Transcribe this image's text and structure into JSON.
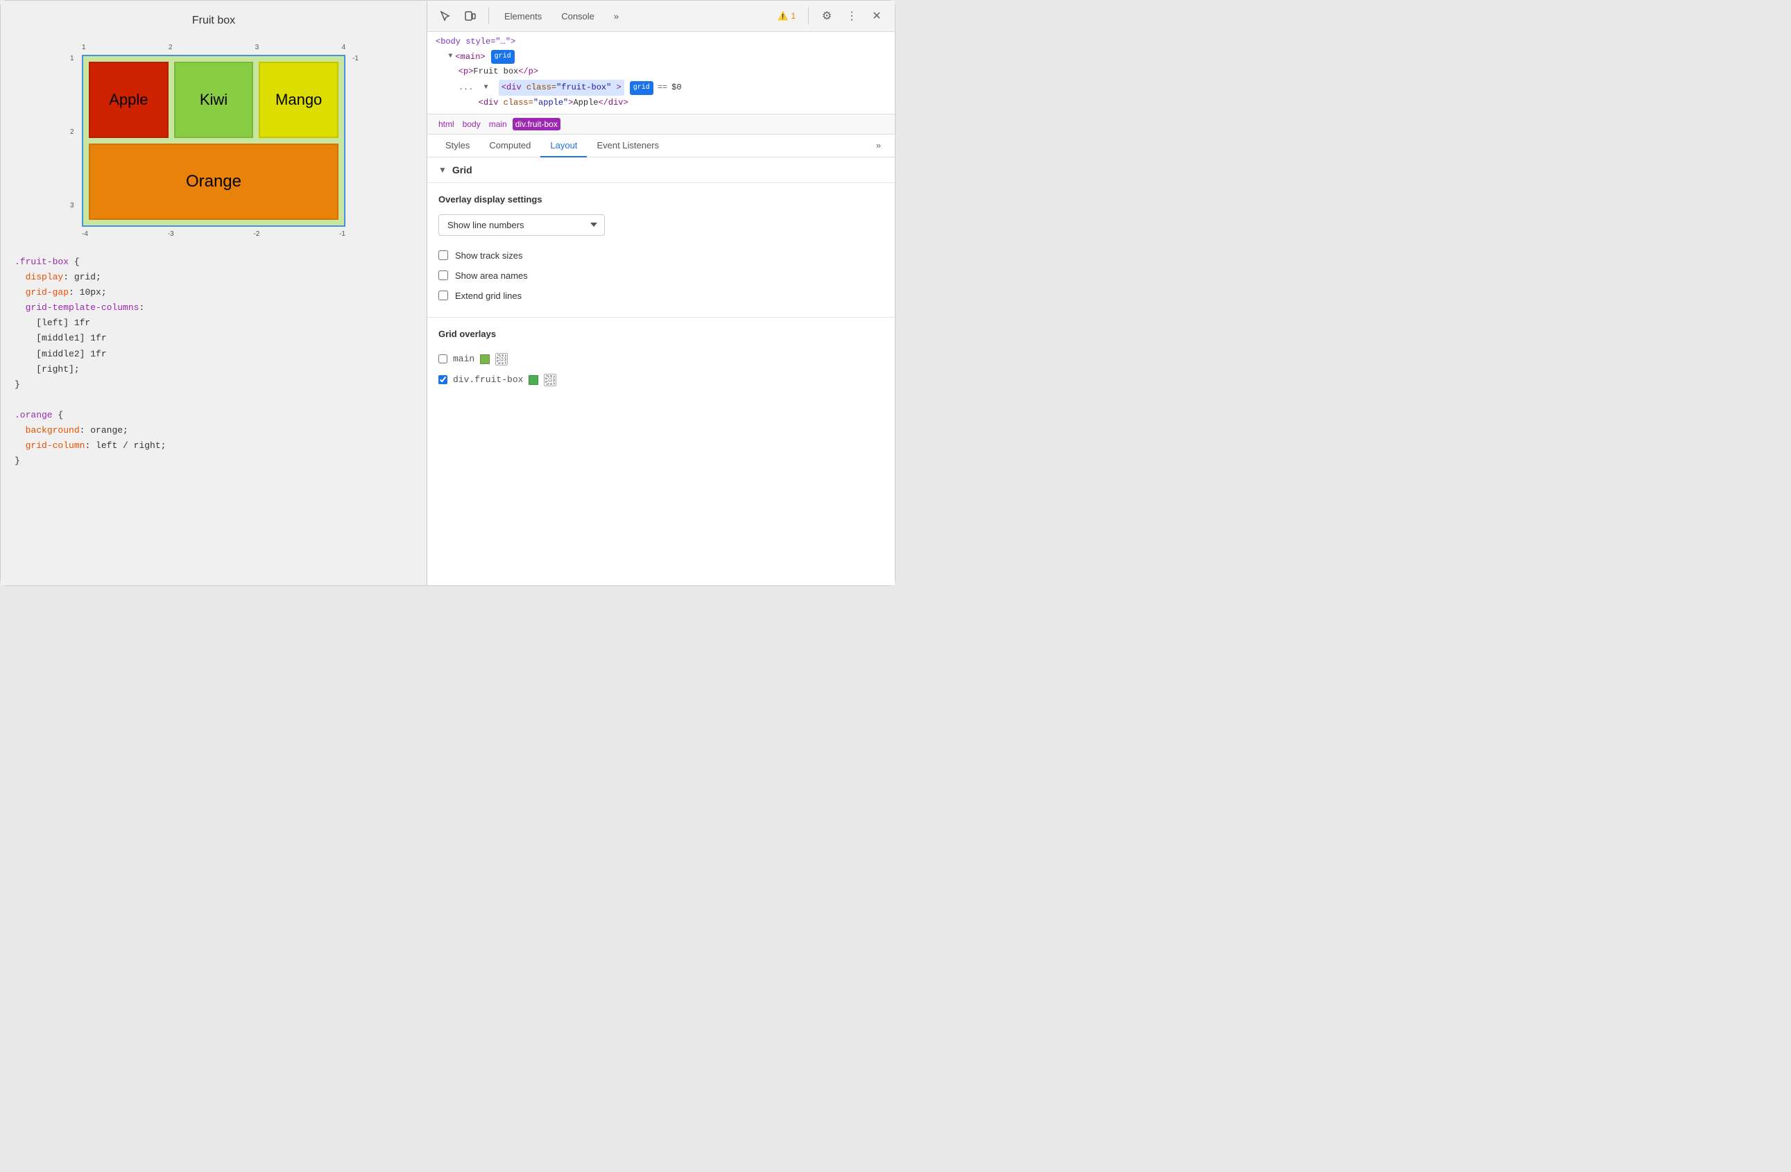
{
  "left": {
    "title": "Fruit box",
    "grid_numbers": {
      "top": [
        "1",
        "2",
        "3",
        "4"
      ],
      "left": [
        "1",
        "2",
        "3"
      ],
      "right": [
        "-1"
      ],
      "bottom": [
        "-4",
        "-3",
        "-2",
        "-1"
      ]
    },
    "cells": {
      "apple": "Apple",
      "kiwi": "Kiwi",
      "mango": "Mango",
      "orange": "Orange"
    },
    "css_lines": [
      ".fruit-box {",
      "  display: grid;",
      "  grid-gap: 10px;",
      "  grid-template-columns:",
      "    [left] 1fr",
      "    [middle1] 1fr",
      "    [middle2] 1fr",
      "    [right];",
      "}",
      "",
      ".orange {",
      "  background: orange;",
      "  grid-column: left / right;",
      "}"
    ]
  },
  "devtools": {
    "header": {
      "tabs": [
        "Elements",
        "Console"
      ],
      "warning_count": "1",
      "more_label": "»"
    },
    "dom": {
      "line1": "<body style=\"...purple...\">",
      "line2": "▼ <main>",
      "main_badge": "grid",
      "line3": "<p>Fruit box</p>",
      "line4_ellipsis": "...",
      "line4": "▼ <div class=\"fruit-box\">",
      "line4_badge": "grid",
      "line4_eq": "==",
      "line4_dollar": "$0",
      "line5": "<div class=\"apple\">Apple</div>"
    },
    "breadcrumb": [
      "html",
      "body",
      "main",
      "div.fruit-box"
    ],
    "tabs": [
      "Styles",
      "Computed",
      "Layout",
      "Event Listeners",
      "»"
    ],
    "active_tab": "Layout",
    "layout": {
      "grid_section_label": "Grid",
      "overlay_title": "Overlay display settings",
      "dropdown_value": "Show line numbers",
      "dropdown_options": [
        "Show line numbers",
        "Show track sizes",
        "Show area names"
      ],
      "show_track_sizes": "Show track sizes",
      "show_area_names": "Show area names",
      "extend_grid_lines": "Extend grid lines",
      "grid_overlays_title": "Grid overlays",
      "overlay_items": [
        {
          "name": "main",
          "color": "#7ab648",
          "checked": false
        },
        {
          "name": "div.fruit-box",
          "color": "#4caf50",
          "checked": true
        }
      ]
    }
  }
}
